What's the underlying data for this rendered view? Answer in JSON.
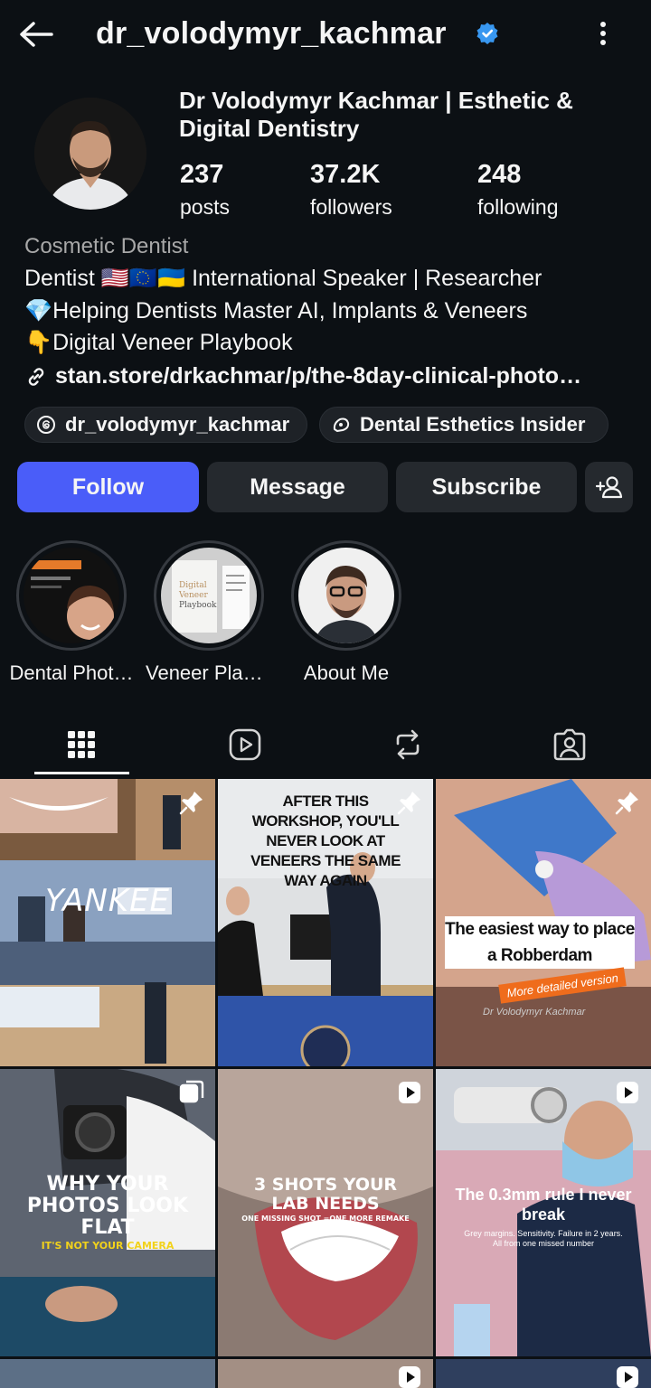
{
  "header": {
    "username": "dr_volodymyr_kachmar",
    "back_icon": "arrow-left-icon",
    "verified_icon": "verified-badge-icon",
    "more_icon": "kebab-menu-icon"
  },
  "profile": {
    "full_name": "Dr Volodymyr Kachmar | Esthetic & Digital Dentistry",
    "stats": [
      {
        "value": "237",
        "label": "posts"
      },
      {
        "value": "37.2K",
        "label": "followers"
      },
      {
        "value": "248",
        "label": "following"
      }
    ],
    "category": "Cosmetic Dentist",
    "bio": [
      "Dentist 🇺🇸🇪🇺🇺🇦 International Speaker | Researcher",
      "💎Helping Dentists Master AI, Implants & Veneers",
      "👇Digital Veneer Playbook"
    ],
    "link": "stan.store/drkachmar/p/the-8day-clinical-photo…",
    "chips": [
      {
        "label": "dr_volodymyr_kachmar",
        "icon": "threads-icon"
      },
      {
        "label": "Dental Esthetics Insider",
        "icon": "broadcast-channel-icon"
      }
    ]
  },
  "actions": {
    "follow": "Follow",
    "message": "Message",
    "subscribe": "Subscribe",
    "add_user_icon": "add-user-icon"
  },
  "highlights": [
    {
      "label": "Dental Phot…"
    },
    {
      "label": "Veneer Play…"
    },
    {
      "label": "About Me"
    }
  ],
  "tabs": [
    "grid-icon",
    "reels-icon",
    "reposts-icon",
    "tagged-icon"
  ],
  "posts": [
    {
      "overlay": "YANKEE",
      "badge": "pin-icon"
    },
    {
      "overlay": "AFTER THIS WORKSHOP, YOU'LL NEVER LOOK AT VENEERS THE SAME WAY AGAIN",
      "badge": "pin-icon"
    },
    {
      "overlay": "The easiest way to place a Robberdam",
      "sub": "More detailed version",
      "credit": "Dr Volodymyr Kachmar",
      "badge": "pin-icon"
    },
    {
      "overlay": "WHY YOUR PHOTOS LOOK FLAT",
      "sub": "IT'S NOT YOUR CAMERA",
      "badge": "carousel-icon"
    },
    {
      "overlay": "3 SHOTS YOUR LAB NEEDS",
      "sub": "ONE MISSING SHOT =ONE MORE REMAKE CYCLE",
      "badge": "reel-icon"
    },
    {
      "overlay": "The 0.3mm rule I never break",
      "sub": "Grey margins. Sensitivity. Failure in 2 years. All from one missed number",
      "badge": "reel-icon"
    }
  ],
  "colors": {
    "background": "#0c1014",
    "primary_button": "#4a5df9",
    "secondary_button": "#25292e",
    "verified": "#3897f0",
    "muted_text": "#a8a8a8"
  }
}
